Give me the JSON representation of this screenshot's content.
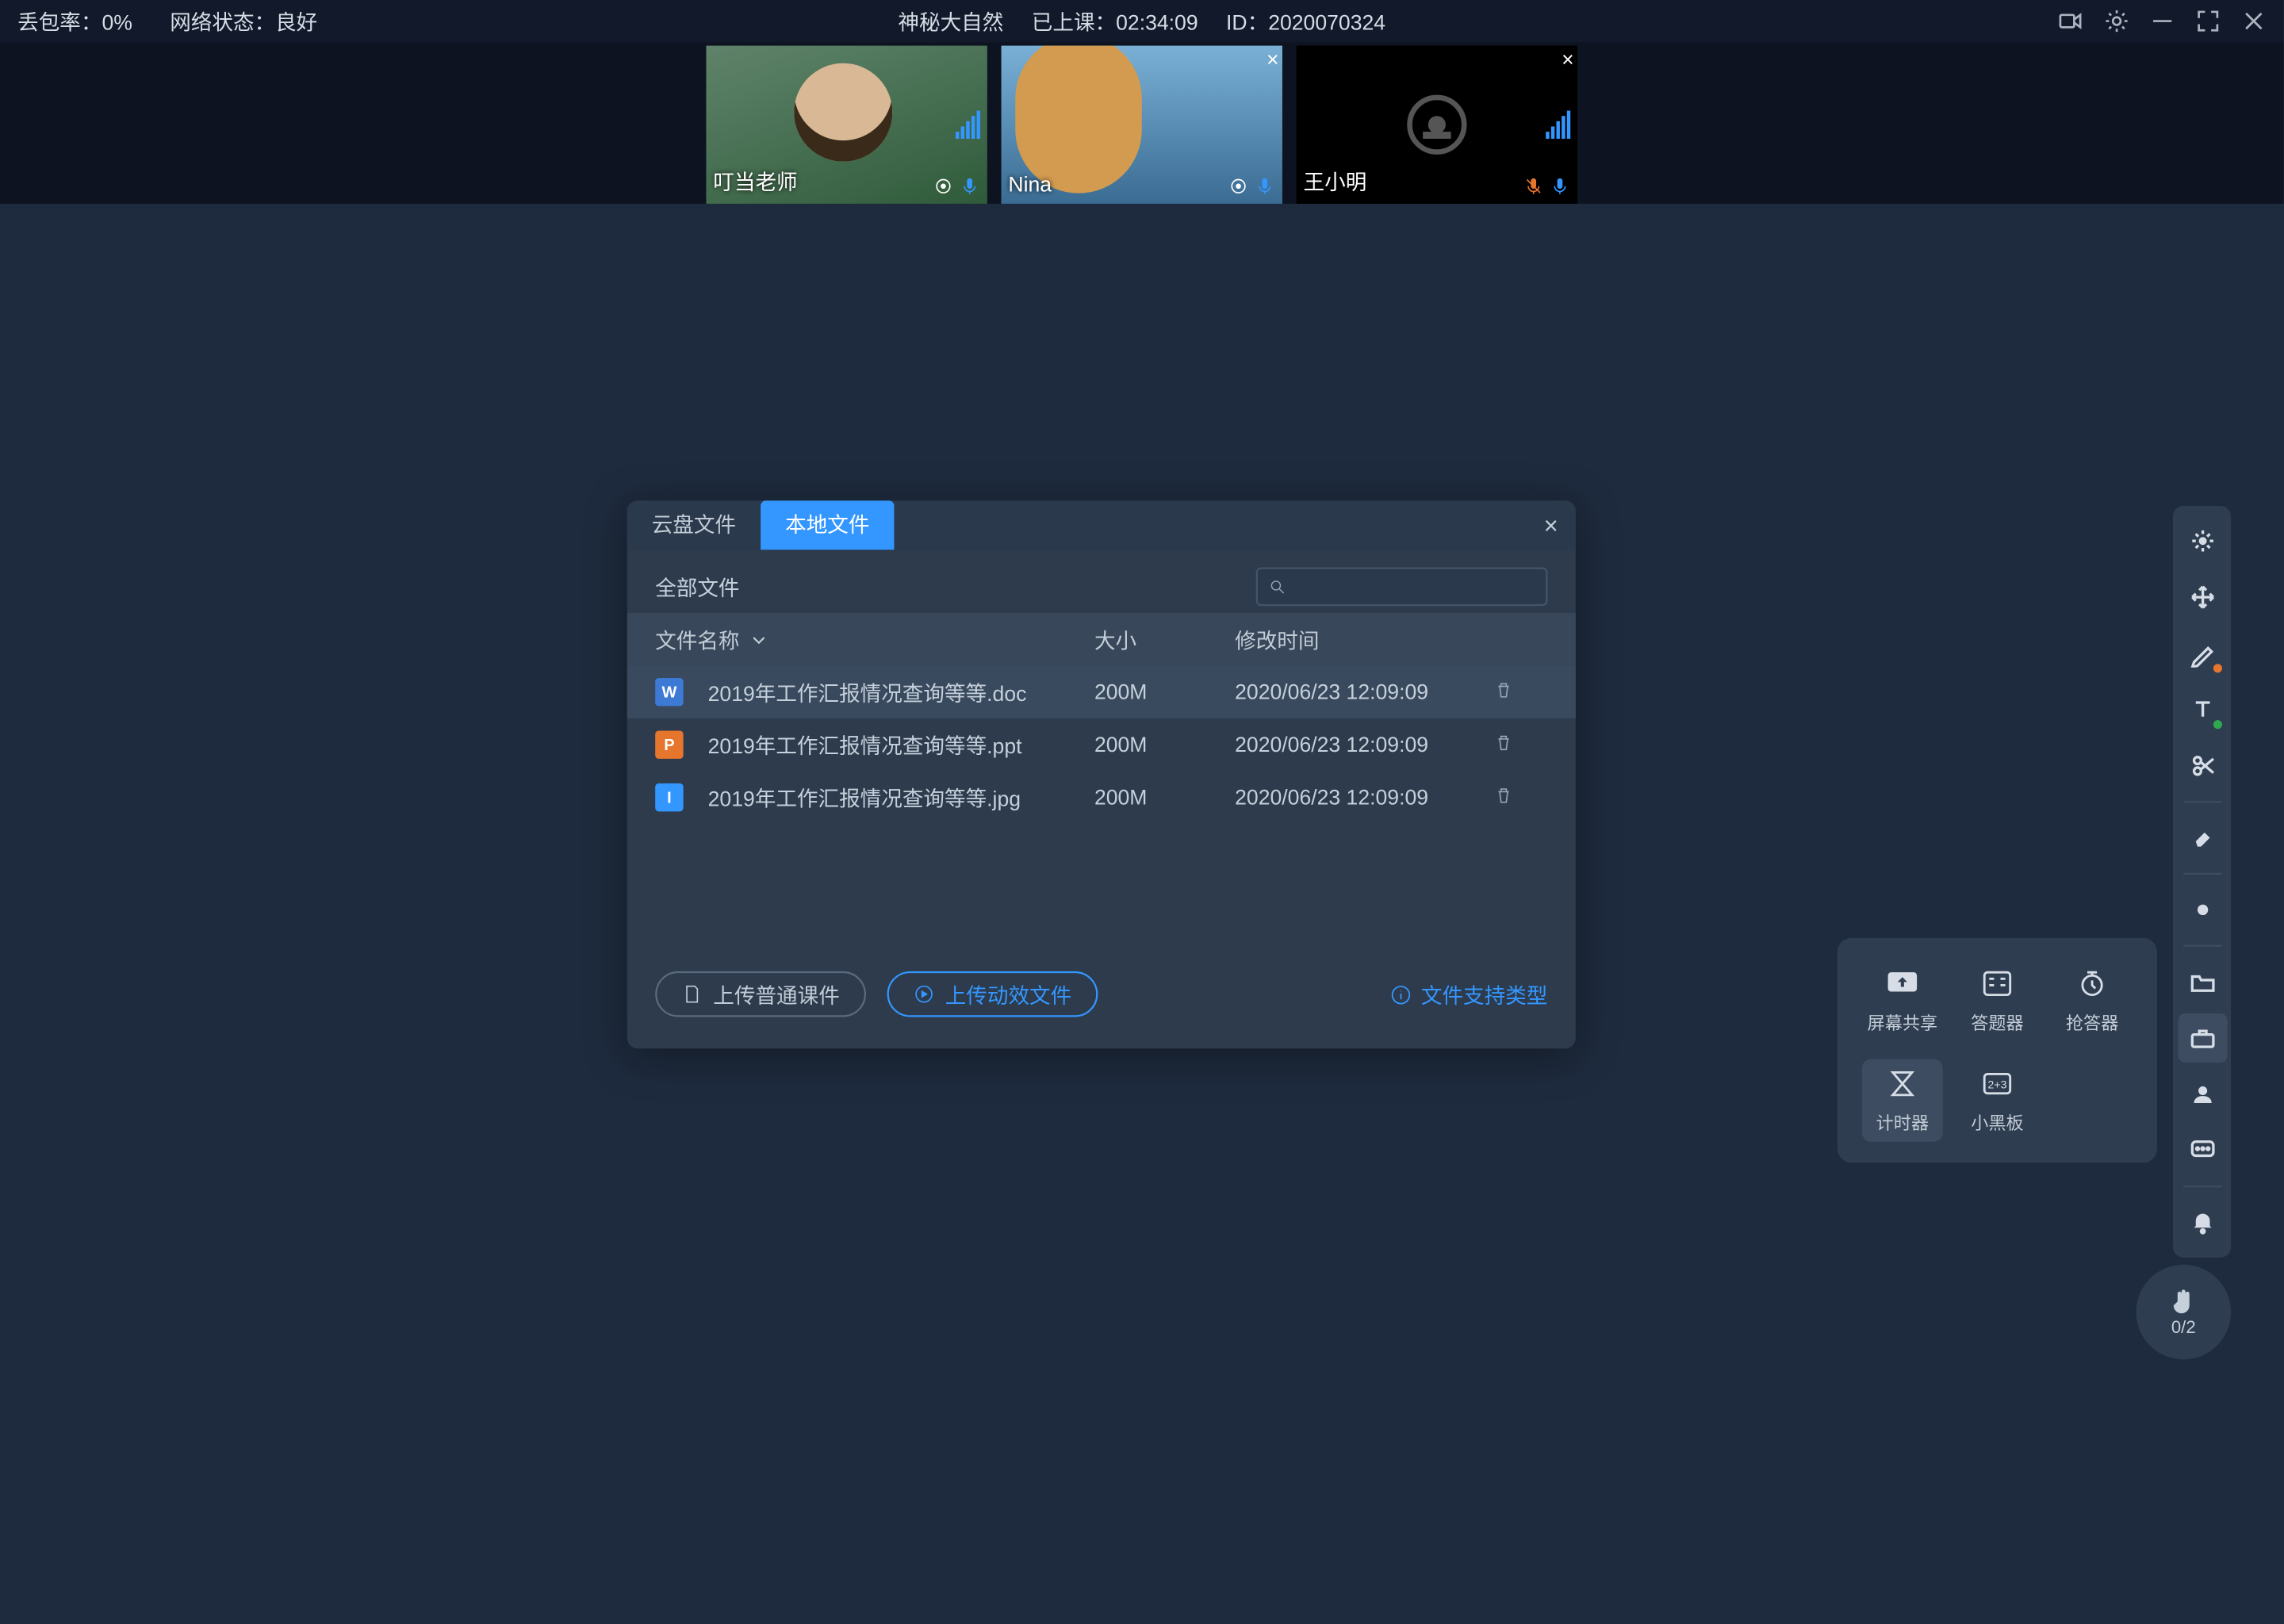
{
  "topbar": {
    "packet_loss_label": "丢包率：0%",
    "net_status_label": "网络状态：良好",
    "title": "神秘大自然",
    "elapsed_label": "已上课：02:34:09",
    "session_id_label": "ID：2020070324"
  },
  "videos": [
    {
      "name": "叮当老师",
      "close": false,
      "cam_off": false,
      "mic_muted": false
    },
    {
      "name": "Nina",
      "close": true,
      "cam_off": false,
      "mic_muted": false
    },
    {
      "name": "王小明",
      "close": true,
      "cam_off": true,
      "mic_muted": true
    }
  ],
  "dialog": {
    "tab_cloud": "云盘文件",
    "tab_local": "本地文件",
    "scope": "全部文件",
    "search_placeholder": "",
    "columns": {
      "name": "文件名称",
      "size": "大小",
      "time": "修改时间"
    },
    "files": [
      {
        "icon": "w",
        "name": "2019年工作汇报情况查询等等.doc",
        "size": "200M",
        "time": "2020/06/23 12:09:09"
      },
      {
        "icon": "p",
        "name": "2019年工作汇报情况查询等等.ppt",
        "size": "200M",
        "time": "2020/06/23 12:09:09"
      },
      {
        "icon": "i",
        "name": "2019年工作汇报情况查询等等.jpg",
        "size": "200M",
        "time": "2020/06/23 12:09:09"
      }
    ],
    "btn_upload_normal": "上传普通课件",
    "btn_upload_anim": "上传动效文件",
    "support_types": "文件支持类型"
  },
  "tools_pop": {
    "screen_share": "屏幕共享",
    "answer": "答题器",
    "responder": "抢答器",
    "timer": "计时器",
    "mini_board": "小黑板"
  },
  "raise": {
    "count": "0/2"
  }
}
